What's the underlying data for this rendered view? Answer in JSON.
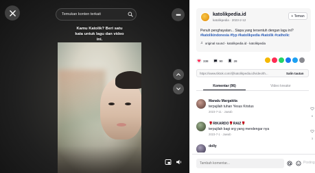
{
  "video": {
    "search_placeholder": "Temukan konten terkait",
    "caption_line1": "Kamu Katolik? Beri satu",
    "caption_line2": "kata untuk lagu dan video",
    "caption_line3": "ini."
  },
  "author": {
    "name": "katolikpedia.id",
    "subline": "katolikpedia · 2023-2-12",
    "follow_label": "+ Teman",
    "description": "Penuh penghayatan... Siapa yang tersentuh dengan lagu ini?",
    "hashtags": "#katolikindonesia #fyp #katolikpedia #katolik #catholic",
    "sound": "original sound - katolikpedia.id - katolikpedia"
  },
  "stats": {
    "likes": "338",
    "comments": "90",
    "saves": "28"
  },
  "share": {
    "link": "https://www.tiktok.com/@katolikpedia.id/video/th...",
    "copy_label": "Salin tautan",
    "colors": [
      "#f5b800",
      "#fe2c55",
      "#25d366",
      "#1877f2",
      "#1da1f2",
      "#8a8b91"
    ]
  },
  "tabs": {
    "comments": "Komentar (96)",
    "creator": "Video kreator"
  },
  "comments": [
    {
      "user": "Manalu Margakita",
      "text": "terpujilah tuhan Yesus Kristus",
      "meta": "2023-7-11 · Jawab",
      "likes": "6"
    },
    {
      "user": "🌹RIKARDO🌹RAIZ🌹",
      "text": "terpujilah bagi org yang mendengar nya",
      "meta": "2023-7-1 · Jawab",
      "likes": "3"
    },
    {
      "user": "dolly",
      "text": "",
      "meta": "",
      "likes": ""
    }
  ],
  "comment_bar": {
    "placeholder": "Tambah komentar...",
    "post_label": "Posting"
  }
}
